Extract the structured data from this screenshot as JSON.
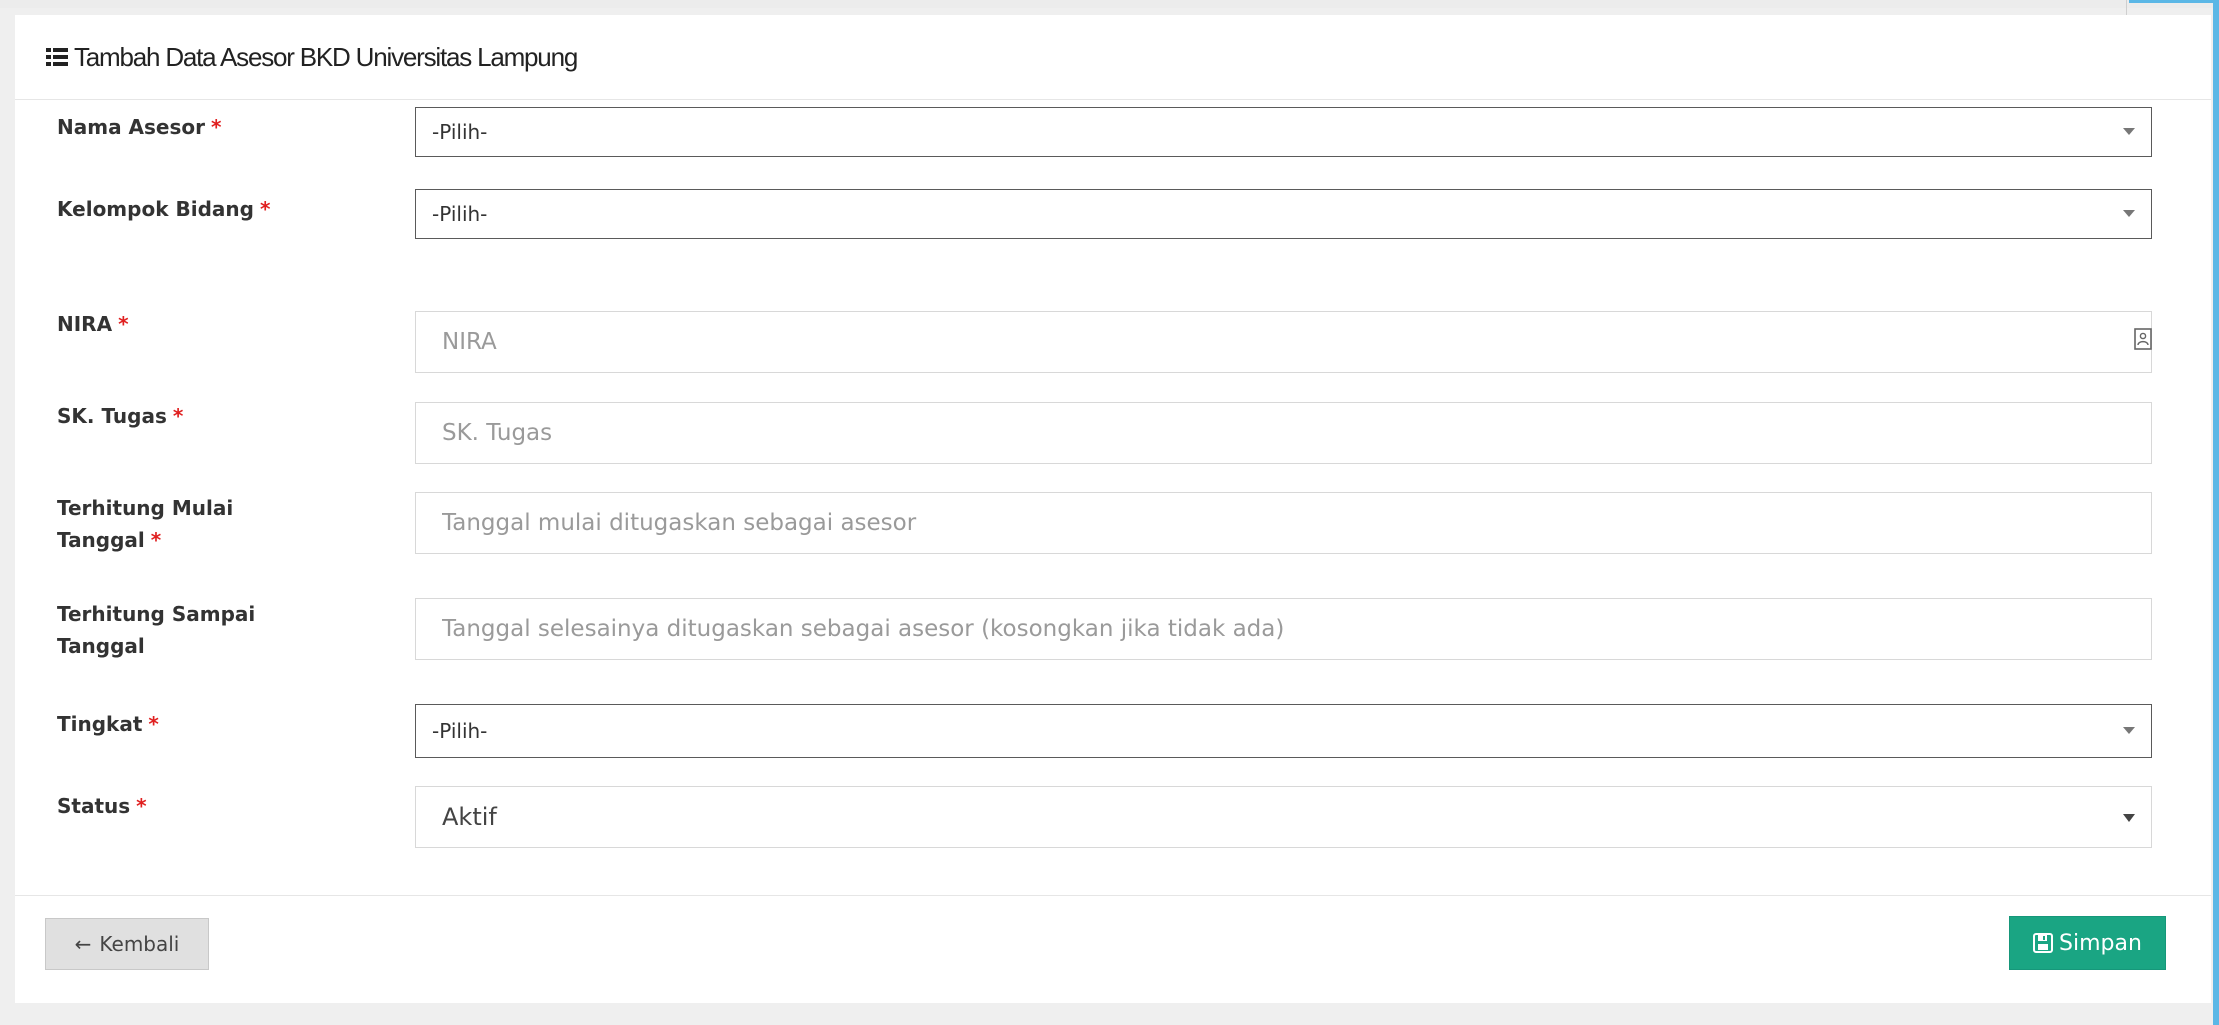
{
  "panel": {
    "title": "Tambah Data Asesor BKD Universitas Lampung"
  },
  "form": {
    "nama_asesor": {
      "label": "Nama Asesor",
      "required": "*",
      "value": "-Pilih-"
    },
    "kelompok_bidang": {
      "label": "Kelompok Bidang",
      "required": "*",
      "value": "-Pilih-"
    },
    "nira": {
      "label": "NIRA",
      "required": "*",
      "placeholder": "NIRA"
    },
    "sk_tugas": {
      "label": "SK. Tugas",
      "required": "*",
      "placeholder": "SK. Tugas"
    },
    "mulai": {
      "label_line1": "Terhitung Mulai",
      "label_line2": "Tanggal",
      "required": "*",
      "placeholder": "Tanggal mulai ditugaskan sebagai asesor"
    },
    "sampai": {
      "label_line1": "Terhitung Sampai",
      "label_line2": "Tanggal",
      "placeholder": "Tanggal selesainya ditugaskan sebagai asesor (kosongkan jika tidak ada)"
    },
    "tingkat": {
      "label": "Tingkat",
      "required": "*",
      "value": "-Pilih-"
    },
    "status": {
      "label": "Status",
      "required": "*",
      "value": "Aktif"
    }
  },
  "footer": {
    "back_label": "Kembali",
    "save_label": "Simpan"
  },
  "colors": {
    "save_button": "#1aa583",
    "required_asterisk": "#e02020",
    "accent_edge": "#5bb7e6"
  },
  "icons": {
    "title": "list-icon",
    "nira": "id-card-icon",
    "back": "arrow-left-icon",
    "save": "floppy-disk-icon",
    "select": "caret-down-icon"
  }
}
